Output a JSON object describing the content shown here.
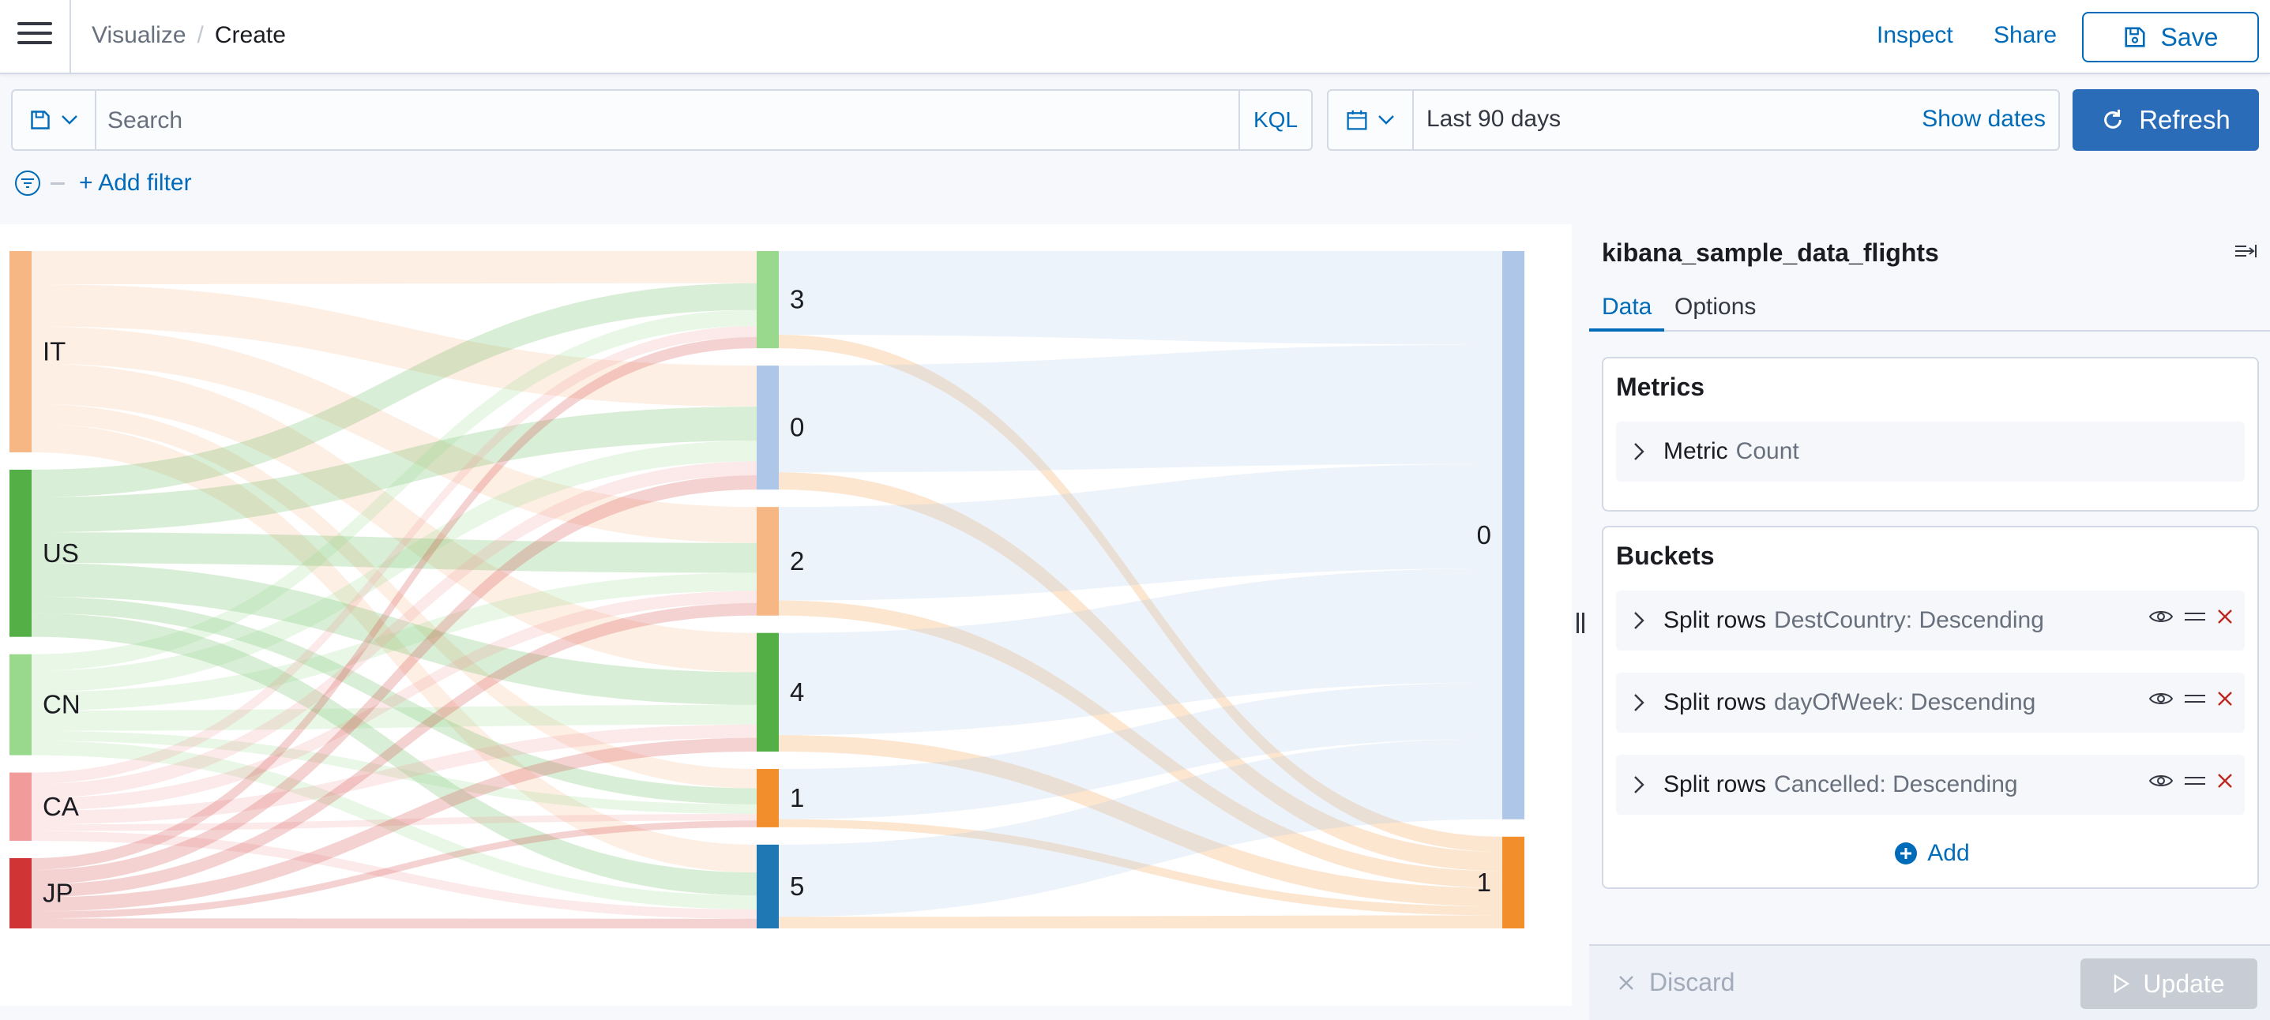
{
  "header": {
    "breadcrumbs": [
      "Visualize",
      "Create"
    ],
    "inspect_label": "Inspect",
    "share_label": "Share",
    "save_label": "Save"
  },
  "query": {
    "placeholder": "Search",
    "language": "KQL"
  },
  "time": {
    "range_label": "Last 90 days",
    "show_dates_label": "Show dates",
    "refresh_label": "Refresh"
  },
  "filters": {
    "add_filter_label": "+ Add filter"
  },
  "chart_data": {
    "type": "sankey",
    "columns": [
      {
        "field": "DestCountry",
        "nodes": [
          "IT",
          "US",
          "CN",
          "CA",
          "JP"
        ]
      },
      {
        "field": "dayOfWeek",
        "nodes": [
          "3",
          "0",
          "2",
          "4",
          "1",
          "5"
        ]
      },
      {
        "field": "Cancelled",
        "nodes": [
          "0",
          "1"
        ]
      }
    ],
    "node_colors": {
      "IT": "#f6b784",
      "US": "#54b046",
      "CN": "#98d98e",
      "CA": "#f19b9b",
      "JP": "#d13434",
      "3": "#98d98e",
      "0": "#aec7e8",
      "2": "#f6b784",
      "4": "#54b046",
      "1": "#f28e2b",
      "5": "#1f77b4"
    },
    "node_values": {
      "DestCountry": {
        "IT": 0.295,
        "US": 0.245,
        "CN": 0.148,
        "CA": 0.1,
        "JP": 0.103
      },
      "dayOfWeek": {
        "3": 0.145,
        "0": 0.185,
        "2": 0.162,
        "4": 0.177,
        "1": 0.087,
        "5": 0.125
      },
      "Cancelled": {
        "0": 0.861,
        "1": 0.139
      }
    }
  },
  "panel": {
    "index_pattern": "kibana_sample_data_flights",
    "tabs": [
      "Data",
      "Options"
    ],
    "metrics_title": "Metrics",
    "metric": {
      "type": "Metric",
      "label": "Count"
    },
    "buckets_title": "Buckets",
    "buckets": [
      {
        "type": "Split rows",
        "label": "DestCountry: Descending"
      },
      {
        "type": "Split rows",
        "label": "dayOfWeek: Descending"
      },
      {
        "type": "Split rows",
        "label": "Cancelled: Descending"
      }
    ],
    "add_label": "Add",
    "discard_label": "Discard",
    "update_label": "Update"
  }
}
